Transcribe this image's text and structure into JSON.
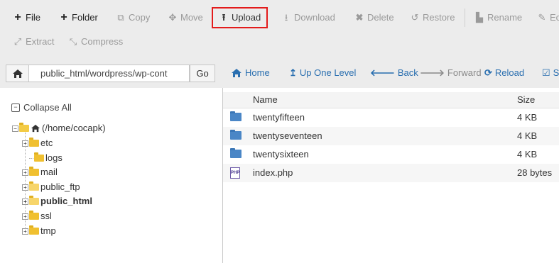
{
  "toolbar": {
    "file": "File",
    "folder": "Folder",
    "copy": "Copy",
    "move": "Move",
    "upload": "Upload",
    "download": "Download",
    "delete": "Delete",
    "restore": "Restore",
    "rename": "Rename",
    "edit": "Ec",
    "extract": "Extract",
    "compress": "Compress"
  },
  "address": {
    "path": "public_html/wordpress/wp-cont",
    "go": "Go"
  },
  "nav": {
    "home": "Home",
    "up": "Up One Level",
    "back": "Back",
    "forward": "Forward",
    "reload": "Reload",
    "select": "S"
  },
  "tree": {
    "collapse_all": "Collapse All",
    "root": "(/home/cocapk)",
    "items": [
      "etc",
      "logs",
      "mail",
      "public_ftp",
      "public_html",
      "ssl",
      "tmp"
    ]
  },
  "table": {
    "headers": {
      "name": "Name",
      "size": "Size"
    },
    "rows": [
      {
        "name": "twentyfifteen",
        "size": "4 KB"
      },
      {
        "name": "twentyseventeen",
        "size": "4 KB"
      },
      {
        "name": "twentysixteen",
        "size": "4 KB"
      },
      {
        "name": "index.php",
        "size": "28 bytes"
      }
    ]
  },
  "colors": {
    "highlight_border": "#e31b1b",
    "link": "#2a6fb0",
    "folder_blue": "#4a86c6",
    "folder_yellow": "#f0c030"
  }
}
